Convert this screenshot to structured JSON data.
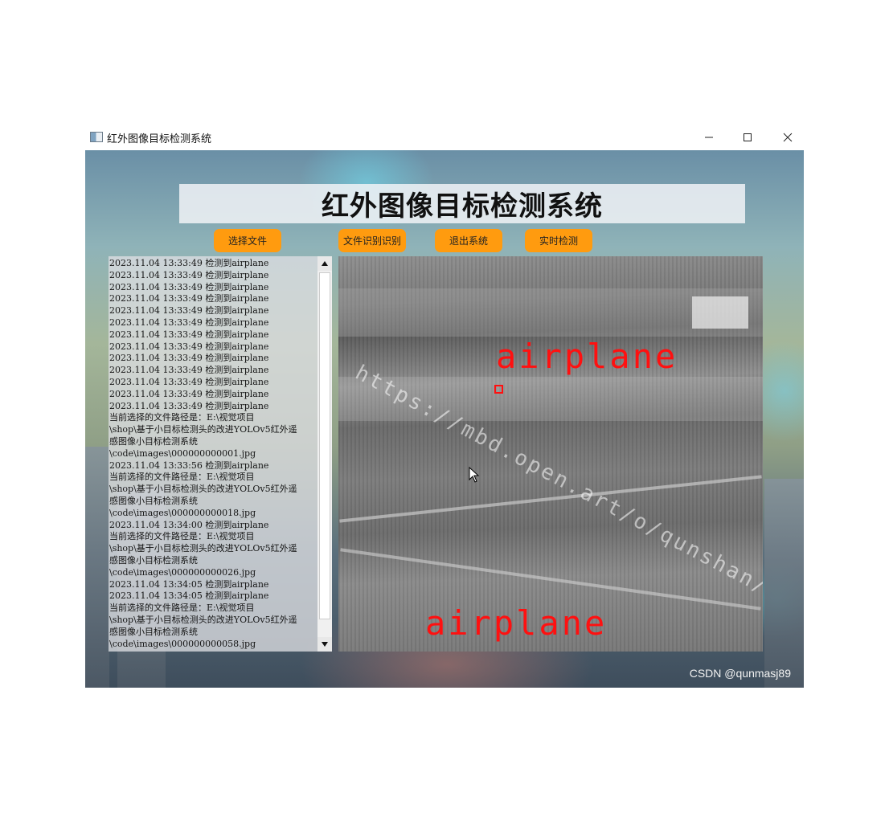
{
  "window": {
    "title": "红外图像目标检测系统",
    "controls": [
      "minimize",
      "maximize",
      "close"
    ]
  },
  "header": {
    "title": "红外图像目标检测系统"
  },
  "buttons": {
    "select_file": "选择文件",
    "file_recognize": "文件识别识别",
    "exit_system": "退出系统",
    "realtime_detect": "实时检测"
  },
  "log": {
    "lines": [
      "2023.11.04 13:33:49 检测到airplane",
      "2023.11.04 13:33:49 检测到airplane",
      "2023.11.04 13:33:49 检测到airplane",
      "2023.11.04 13:33:49 检测到airplane",
      "2023.11.04 13:33:49 检测到airplane",
      "2023.11.04 13:33:49 检测到airplane",
      "2023.11.04 13:33:49 检测到airplane",
      "2023.11.04 13:33:49 检测到airplane",
      "2023.11.04 13:33:49 检测到airplane",
      "2023.11.04 13:33:49 检测到airplane",
      "2023.11.04 13:33:49 检测到airplane",
      "2023.11.04 13:33:49 检测到airplane",
      "2023.11.04 13:33:49 检测到airplane",
      "当前选择的文件路径是：E:\\视觉项目",
      "\\shop\\基于小目标检测头的改进YOLOv5红外遥",
      "感图像小目标检测系统",
      "\\code\\images\\000000000001.jpg",
      "2023.11.04 13:33:56 检测到airplane",
      "当前选择的文件路径是：E:\\视觉项目",
      "\\shop\\基于小目标检测头的改进YOLOv5红外遥",
      "感图像小目标检测系统",
      "\\code\\images\\000000000018.jpg",
      "2023.11.04 13:34:00 检测到airplane",
      "当前选择的文件路径是：E:\\视觉项目",
      "\\shop\\基于小目标检测头的改进YOLOv5红外遥",
      "感图像小目标检测系统",
      "\\code\\images\\000000000026.jpg",
      "2023.11.04 13:34:05 检测到airplane",
      "2023.11.04 13:34:05 检测到airplane",
      "当前选择的文件路径是：E:\\视觉项目",
      "\\shop\\基于小目标检测头的改进YOLOv5红外遥",
      "感图像小目标检测系统",
      "\\code\\images\\000000000058.jpg"
    ]
  },
  "detection": {
    "labels": [
      "airplane",
      "airplane"
    ],
    "watermark": "https://mbd.open.art/o/qunshan/work",
    "label_color": "#ff1010"
  },
  "footer": {
    "credit": "CSDN @qunmasj89"
  },
  "colors": {
    "button": "#ff9b0f",
    "banner_bg": "#f0f2f6"
  }
}
